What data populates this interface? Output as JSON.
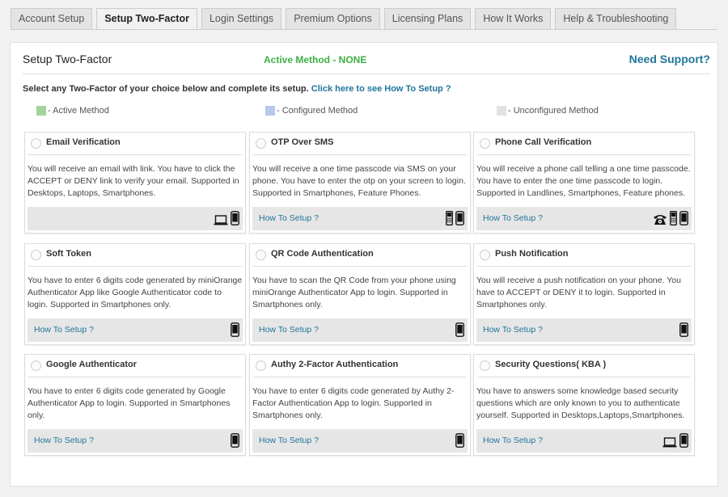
{
  "tabs": [
    {
      "label": "Account Setup",
      "active": false
    },
    {
      "label": "Setup Two-Factor",
      "active": true
    },
    {
      "label": "Login Settings",
      "active": false
    },
    {
      "label": "Premium Options",
      "active": false
    },
    {
      "label": "Licensing Plans",
      "active": false
    },
    {
      "label": "How It Works",
      "active": false
    },
    {
      "label": "Help & Troubleshooting",
      "active": false
    }
  ],
  "header": {
    "title": "Setup Two-Factor",
    "active_method": "Active Method - NONE",
    "support_link": "Need Support?"
  },
  "intro": {
    "text": "Select any Two-Factor of your choice below and complete its setup.",
    "link": "Click here to see How To Setup ?"
  },
  "legend": [
    {
      "label": "- Active Method",
      "color": "#a3d39c"
    },
    {
      "label": "- Configured Method",
      "color": "#b8c8ec"
    },
    {
      "label": "- Unconfigured Method",
      "color": "#e2e2e2"
    }
  ],
  "methods": [
    {
      "title": "Email Verification",
      "description": "You will receive an email with link. You have to click the ACCEPT or DENY link to verify your email. Supported in Desktops, Laptops, Smartphones.",
      "howto": "",
      "devices": [
        "laptop-icon",
        "smartphone-icon"
      ]
    },
    {
      "title": "OTP Over SMS",
      "description": "You will receive a one time passcode via SMS on your phone. You have to enter the otp on your screen to login. Supported in Smartphones, Feature Phones.",
      "howto": "How To Setup ?",
      "devices": [
        "feature-phone-icon",
        "smartphone-icon"
      ]
    },
    {
      "title": "Phone Call Verification",
      "description": "You will receive a phone call telling a one time passcode. You have to enter the one time passcode to login. Supported in Landlines, Smartphones, Feature phones.",
      "howto": "How To Setup ?",
      "devices": [
        "landline-phone-icon",
        "feature-phone-icon",
        "smartphone-icon"
      ]
    },
    {
      "title": "Soft Token",
      "description": "You have to enter 6 digits code generated by miniOrange Authenticator App like Google Authenticator code to login. Supported in Smartphones only.",
      "howto": "How To Setup ?",
      "devices": [
        "smartphone-icon"
      ]
    },
    {
      "title": "QR Code Authentication",
      "description": "You have to scan the QR Code from your phone using miniOrange Authenticator App to login. Supported in Smartphones only.",
      "howto": "How To Setup ?",
      "devices": [
        "smartphone-icon"
      ]
    },
    {
      "title": "Push Notification",
      "description": "You will receive a push notification on your phone. You have to ACCEPT or DENY it to login. Supported in Smartphones only.",
      "howto": "How To Setup ?",
      "devices": [
        "smartphone-icon"
      ]
    },
    {
      "title": "Google Authenticator",
      "description": "You have to enter 6 digits code generated by Google Authenticator App to login. Supported in Smartphones only.",
      "howto": "How To Setup ?",
      "devices": [
        "smartphone-icon"
      ]
    },
    {
      "title": "Authy 2-Factor Authentication",
      "description": "You have to enter 6 digits code generated by Authy 2-Factor Authentication App to login. Supported in Smartphones only.",
      "howto": "How To Setup ?",
      "devices": [
        "smartphone-icon"
      ]
    },
    {
      "title": "Security Questions( KBA )",
      "description": "You have to answers some knowledge based security questions which are only known to you to authenticate yourself. Supported in Desktops,Laptops,Smartphones.",
      "howto": "How To Setup ?",
      "devices": [
        "laptop-icon",
        "smartphone-icon"
      ]
    }
  ]
}
